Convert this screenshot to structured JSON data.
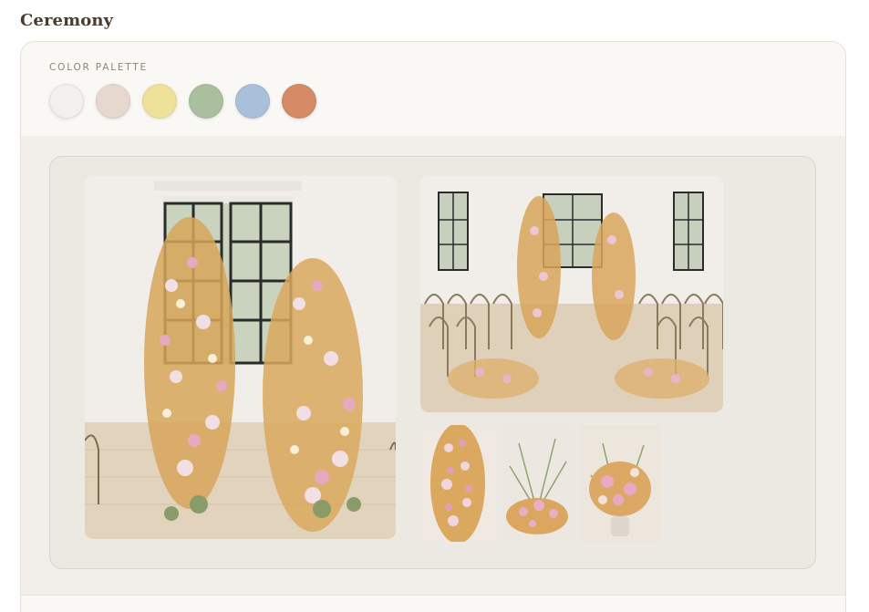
{
  "section": {
    "title": "Ceremony"
  },
  "palette": {
    "label": "COLOR PALETTE",
    "colors": [
      "#f2f0ed",
      "#e6d8cf",
      "#eee29a",
      "#a9bf9e",
      "#a8c0d8",
      "#d58b66"
    ]
  },
  "gallery": {
    "images": [
      {
        "subject": "floral-arch-window"
      },
      {
        "subject": "ceremony-aisle-chairs"
      },
      {
        "subject": "floral-column-detail"
      },
      {
        "subject": "ground-floral-arrangement"
      },
      {
        "subject": "vase-floral-bouquet"
      }
    ]
  }
}
